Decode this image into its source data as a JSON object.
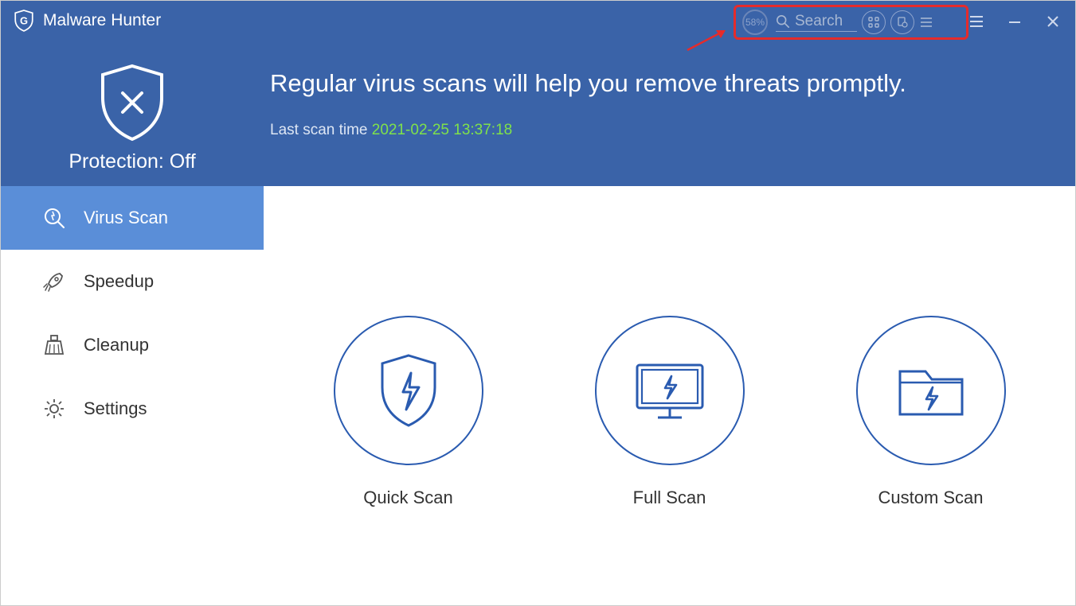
{
  "app": {
    "title": "Malware Hunter"
  },
  "topbar": {
    "percent": "58%",
    "search_placeholder": "Search"
  },
  "header": {
    "protection_label": "Protection: Off",
    "heading": "Regular virus scans will help you remove threats promptly.",
    "last_scan_prefix": "Last scan time ",
    "last_scan_time": "2021-02-25 13:37:18"
  },
  "sidebar": {
    "items": [
      {
        "label": "Virus Scan"
      },
      {
        "label": "Speedup"
      },
      {
        "label": "Cleanup"
      },
      {
        "label": "Settings"
      }
    ]
  },
  "scans": {
    "quick": "Quick Scan",
    "full": "Full Scan",
    "custom": "Custom Scan"
  }
}
